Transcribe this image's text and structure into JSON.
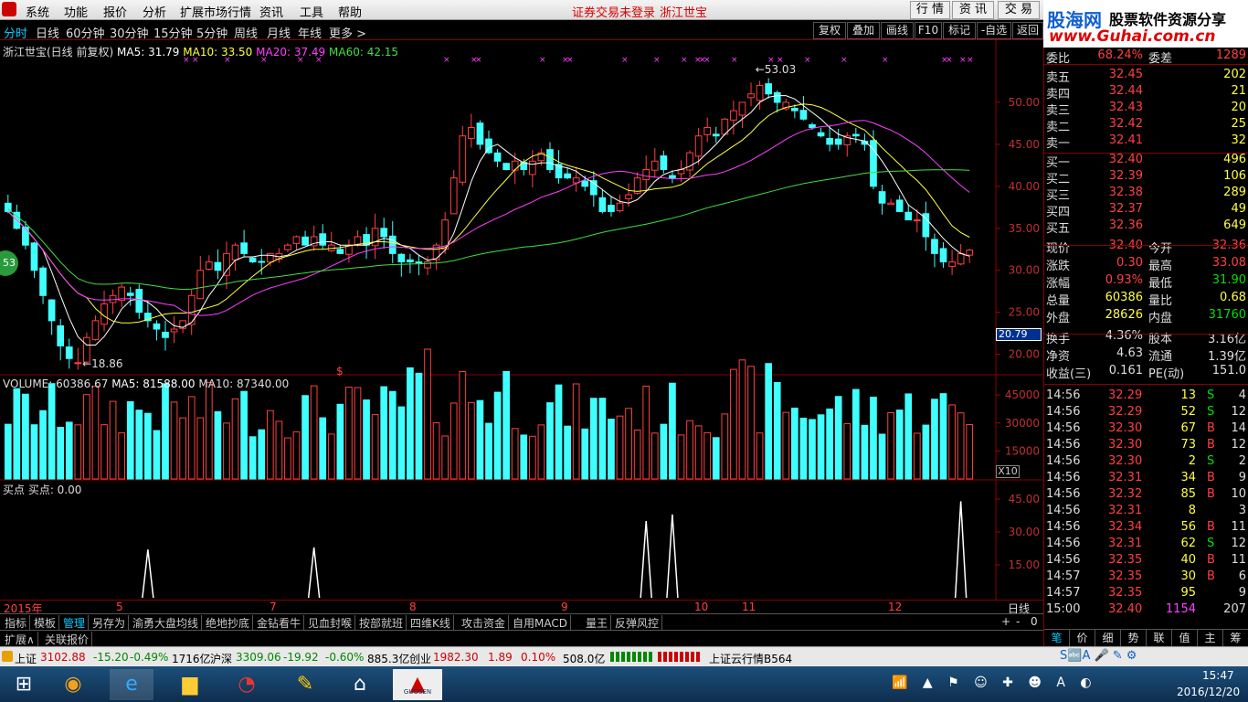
{
  "menu": {
    "items": [
      "系统",
      "功能",
      "报价",
      "分析",
      "扩展市场行情",
      "资讯",
      "工具",
      "帮助"
    ],
    "warning": "证券交易未登录",
    "stock_name": "浙江世宝",
    "right_buttons": [
      "行 情",
      "资 讯",
      "交 易"
    ]
  },
  "periods": [
    "分时",
    "日线",
    "60分钟",
    "30分钟",
    "15分钟",
    "5分钟",
    "周线",
    "月线",
    "年线",
    "更多 >"
  ],
  "toolbar_buttons": [
    "复权",
    "叠加",
    "画线",
    "F10",
    "标记",
    "-自选",
    "返回"
  ],
  "main_chart": {
    "title": "浙江世宝(日线 前复权)",
    "ma5": "MA5: 31.79",
    "ma10": "MA10: 33.50",
    "ma20": "MA20: 37.49",
    "ma60": "MA60: 42.15",
    "high_label": "53.03",
    "low_label": "18.86",
    "badge": "53",
    "marker": "$",
    "price_box": "20.79",
    "yticks": [
      "50.00",
      "45.00",
      "40.00",
      "35.00",
      "30.00",
      "25.00",
      "20.00"
    ]
  },
  "volume_chart": {
    "title": "VOLUME: 60386.67",
    "ma5": "MA5: 81588.00",
    "ma10": "MA10: 87340.00",
    "yticks": [
      "45000",
      "30000",
      "15000"
    ],
    "unit": "X10"
  },
  "signal_chart": {
    "title": "买点 买点: 0.00",
    "yticks": [
      "45.00",
      "30.00",
      "15.00"
    ]
  },
  "xaxis": {
    "labels": [
      "2015年",
      "5",
      "7",
      "8",
      "9",
      "10",
      "11",
      "12"
    ],
    "period": "日线",
    "controls": [
      "+",
      "-",
      "0"
    ]
  },
  "formula_tabs": [
    "指标",
    "模板",
    "管理",
    "另存为",
    "渝勇大盘均线",
    "绝地抄底",
    "金钻看牛",
    "见血封喉",
    "按部就班",
    "四维K线",
    "攻击资金",
    "自用MACD",
    "量王",
    "反弹风控"
  ],
  "bottom_tabs": [
    "扩展∧",
    "关联报价"
  ],
  "logo": {
    "line1": "股海网",
    "line1b": "股票软件资源分享",
    "line2": "www.Guhai.com.cn"
  },
  "order_book": {
    "weibi": {
      "label": "委比",
      "value": "68.24%",
      "label2": "委差",
      "value2": "1289"
    },
    "sells": [
      {
        "label": "卖五",
        "price": "32.45",
        "vol": "202"
      },
      {
        "label": "卖四",
        "price": "32.44",
        "vol": "21"
      },
      {
        "label": "卖三",
        "price": "32.43",
        "vol": "20"
      },
      {
        "label": "卖二",
        "price": "32.42",
        "vol": "25"
      },
      {
        "label": "卖一",
        "price": "32.41",
        "vol": "32"
      }
    ],
    "buys": [
      {
        "label": "买一",
        "price": "32.40",
        "vol": "496"
      },
      {
        "label": "买二",
        "price": "32.39",
        "vol": "106"
      },
      {
        "label": "买三",
        "price": "32.38",
        "vol": "289"
      },
      {
        "label": "买四",
        "price": "32.37",
        "vol": "49"
      },
      {
        "label": "买五",
        "price": "32.36",
        "vol": "649"
      }
    ]
  },
  "quote": [
    {
      "l1": "现价",
      "v1": "32.40",
      "l2": "今开",
      "v2": "32.36"
    },
    {
      "l1": "涨跌",
      "v1": "0.30",
      "l2": "最高",
      "v2": "33.08"
    },
    {
      "l1": "涨幅",
      "v1": "0.93%",
      "l2": "最低",
      "v2": "31.90"
    },
    {
      "l1": "总量",
      "v1": "60386",
      "l2": "量比",
      "v2": "0.68"
    },
    {
      "l1": "外盘",
      "v1": "28626",
      "l2": "内盘",
      "v2": "31760"
    }
  ],
  "fundamentals": [
    {
      "l1": "换手",
      "v1": "4.36%",
      "l2": "股本",
      "v2": "3.16亿"
    },
    {
      "l1": "净资",
      "v1": "4.63",
      "l2": "流通",
      "v2": "1.39亿"
    },
    {
      "l1": "收益(三)",
      "v1": "0.161",
      "l2": "PE(动)",
      "v2": "151.0"
    }
  ],
  "ticks": [
    {
      "t": "14:56",
      "p": "32.29",
      "v": "13",
      "d": "S",
      "n": "4"
    },
    {
      "t": "14:56",
      "p": "32.29",
      "v": "52",
      "d": "S",
      "n": "12"
    },
    {
      "t": "14:56",
      "p": "32.30",
      "v": "67",
      "d": "B",
      "n": "14"
    },
    {
      "t": "14:56",
      "p": "32.30",
      "v": "73",
      "d": "B",
      "n": "12"
    },
    {
      "t": "14:56",
      "p": "32.30",
      "v": "2",
      "d": "S",
      "n": "2"
    },
    {
      "t": "14:56",
      "p": "32.31",
      "v": "34",
      "d": "B",
      "n": "9"
    },
    {
      "t": "14:56",
      "p": "32.32",
      "v": "85",
      "d": "B",
      "n": "10"
    },
    {
      "t": "14:56",
      "p": "32.31",
      "v": "8",
      "d": "",
      "n": "3"
    },
    {
      "t": "14:56",
      "p": "32.34",
      "v": "56",
      "d": "B",
      "n": "11"
    },
    {
      "t": "14:56",
      "p": "32.31",
      "v": "62",
      "d": "S",
      "n": "12"
    },
    {
      "t": "14:56",
      "p": "32.35",
      "v": "40",
      "d": "B",
      "n": "11"
    },
    {
      "t": "14:57",
      "p": "32.35",
      "v": "30",
      "d": "B",
      "n": "6"
    },
    {
      "t": "14:57",
      "p": "32.35",
      "v": "95",
      "d": "",
      "n": "9"
    },
    {
      "t": "15:00",
      "p": "32.40",
      "v": "1154",
      "d": "",
      "n": "207"
    }
  ],
  "right_tabs": [
    "笔",
    "价",
    "细",
    "势",
    "联",
    "值",
    "主",
    "筹"
  ],
  "status": {
    "sh_label": "上证",
    "sh_val": "3102.88",
    "sh_chg": "-15.20",
    "sh_pct": "-0.49%",
    "sh_amt": "1716亿",
    "sz_label": "沪深",
    "sz_val": "3309.06",
    "sz_chg": "-19.92",
    "sz_pct": "-0.60%",
    "sz_amt": "885.3亿",
    "cy_label": "创业",
    "cy_val": "1982.30",
    "cy_chg": "1.89",
    "cy_pct": "0.10%",
    "cy_amt": "508.0亿",
    "ticker": "上证云行情B564"
  },
  "taskbar": {
    "time": "15:47",
    "date": "2016/12/20",
    "app_label": "GUOSEN"
  },
  "chart_data": {
    "type": "candlestick",
    "ylim": [
      18,
      55
    ],
    "x_labels": [
      "2015年",
      "5",
      "7",
      "8",
      "9",
      "10",
      "11",
      "12"
    ],
    "ma_colors": {
      "ma5": "#ffffff",
      "ma10": "#ffff40",
      "ma20": "#ff40ff",
      "ma60": "#40e040"
    },
    "highest": 53.03,
    "lowest": 18.86,
    "closes": [
      37,
      35,
      33,
      30,
      27,
      24,
      21,
      19.5,
      19,
      22,
      24,
      26,
      27,
      28,
      27,
      25,
      24,
      23,
      22,
      23,
      24,
      27,
      30,
      31,
      30,
      32,
      33,
      32,
      31,
      31,
      32,
      32,
      33,
      34,
      33,
      34,
      33,
      33,
      32,
      33,
      34,
      33,
      35,
      34,
      32,
      31,
      31,
      31,
      31,
      33,
      36,
      41,
      46,
      47,
      45,
      44,
      43,
      42,
      43,
      42,
      43,
      44,
      42,
      41,
      41,
      41,
      40,
      39,
      37,
      37,
      38,
      39,
      41,
      42,
      43,
      42,
      41,
      42,
      44,
      46,
      47,
      46,
      48,
      49,
      50,
      51,
      52,
      51,
      50,
      50,
      49,
      48,
      47,
      46,
      45,
      45,
      46,
      46,
      45,
      40,
      38,
      38,
      37,
      36,
      36,
      34,
      32,
      31,
      31,
      32,
      32.4
    ],
    "volume_ylim": [
      0,
      48000
    ],
    "signal_ylim": [
      0,
      50
    ],
    "signal_peaks": [
      {
        "i": 16,
        "v": 22
      },
      {
        "i": 35,
        "v": 23
      },
      {
        "i": 73,
        "v": 35
      },
      {
        "i": 76,
        "v": 38
      },
      {
        "i": 109,
        "v": 44
      }
    ]
  }
}
